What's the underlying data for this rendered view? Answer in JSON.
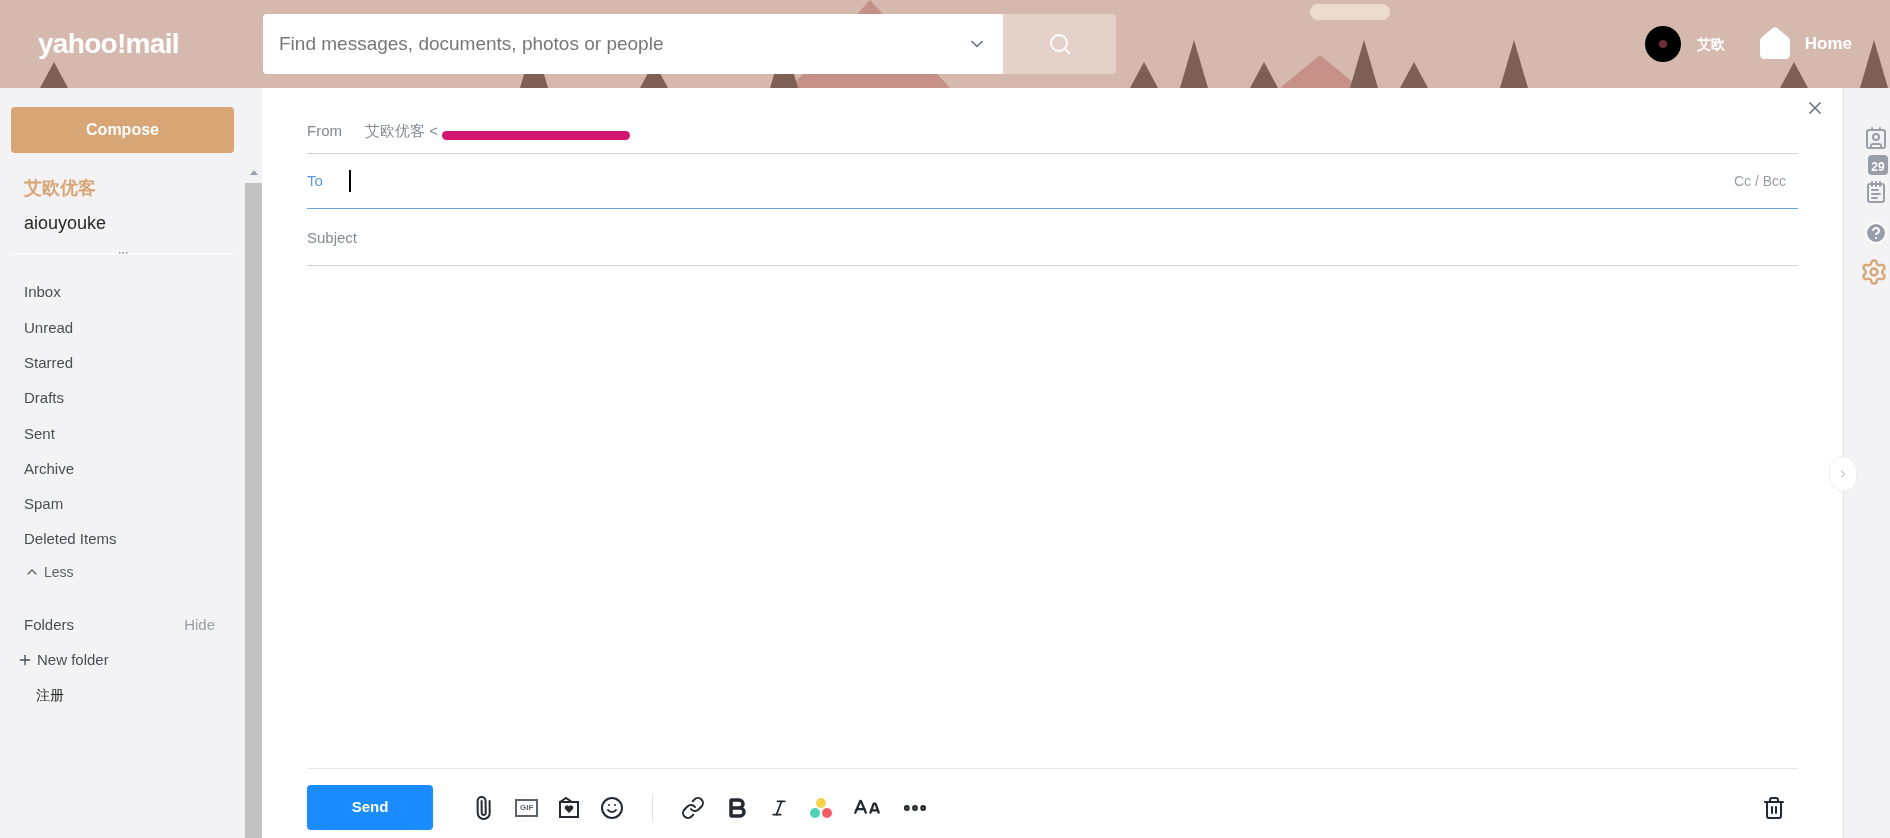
{
  "header": {
    "logo": "yahoo!mail",
    "search": {
      "placeholder": "Find messages, documents, photos or people"
    },
    "user_name": "艾欧",
    "home": "Home"
  },
  "sidebar": {
    "compose": "Compose",
    "display_name": "艾欧优客",
    "account": "aiouyouke",
    "items": [
      {
        "label": "Inbox"
      },
      {
        "label": "Unread"
      },
      {
        "label": "Starred"
      },
      {
        "label": "Drafts"
      },
      {
        "label": "Sent"
      },
      {
        "label": "Archive"
      },
      {
        "label": "Spam"
      },
      {
        "label": "Deleted Items"
      }
    ],
    "less": "Less",
    "folders": {
      "title": "Folders",
      "toggle": "Hide",
      "new_folder": "New folder",
      "items": [
        {
          "label": "注册"
        }
      ]
    }
  },
  "compose": {
    "from_label": "From",
    "from_value": "艾欧优客 <",
    "to_label": "To",
    "to_focused": true,
    "cc_bcc": "Cc / Bcc",
    "subject": {
      "placeholder": "Subject"
    },
    "toolbar": {
      "send": "Send",
      "gif": "GIF"
    }
  },
  "right_rail": {
    "calendar_day": "29"
  }
}
